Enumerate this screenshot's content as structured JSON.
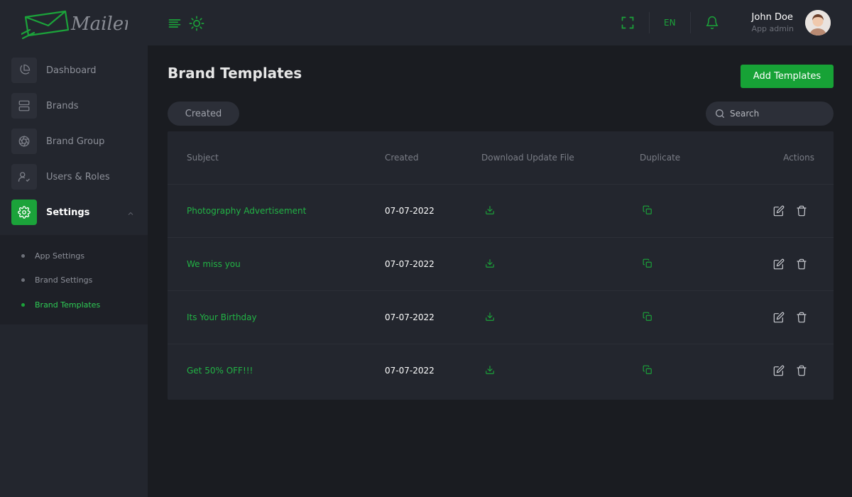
{
  "app": {
    "name": "Mailer"
  },
  "colors": {
    "accent": "#1ba33a",
    "bg": "#1a1c21",
    "panel": "#23262e"
  },
  "sidebar": {
    "items": [
      {
        "label": "Dashboard",
        "icon": "pie-chart-icon"
      },
      {
        "label": "Brands",
        "icon": "server-icon"
      },
      {
        "label": "Brand Group",
        "icon": "aperture-icon"
      },
      {
        "label": "Users & Roles",
        "icon": "user-check-icon"
      },
      {
        "label": "Settings",
        "icon": "gear-icon"
      }
    ],
    "submenu": [
      {
        "label": "App Settings"
      },
      {
        "label": "Brand Settings"
      },
      {
        "label": "Brand Templates"
      }
    ]
  },
  "topbar": {
    "language": "EN",
    "user": {
      "name": "John Doe",
      "role": "App admin"
    }
  },
  "page": {
    "title": "Brand Templates",
    "add_button": "Add Templates",
    "filter_chip": "Created",
    "search_placeholder": "Search"
  },
  "table": {
    "headers": {
      "subject": "Subject",
      "created": "Created",
      "download": "Download Update File",
      "duplicate": "Duplicate",
      "actions": "Actions"
    },
    "rows": [
      {
        "subject": "Photography Advertisement",
        "created": "07-07-2022"
      },
      {
        "subject": "We miss you",
        "created": "07-07-2022"
      },
      {
        "subject": "Its Your Birthday",
        "created": "07-07-2022"
      },
      {
        "subject": "Get 50% OFF!!!",
        "created": "07-07-2022"
      }
    ]
  }
}
